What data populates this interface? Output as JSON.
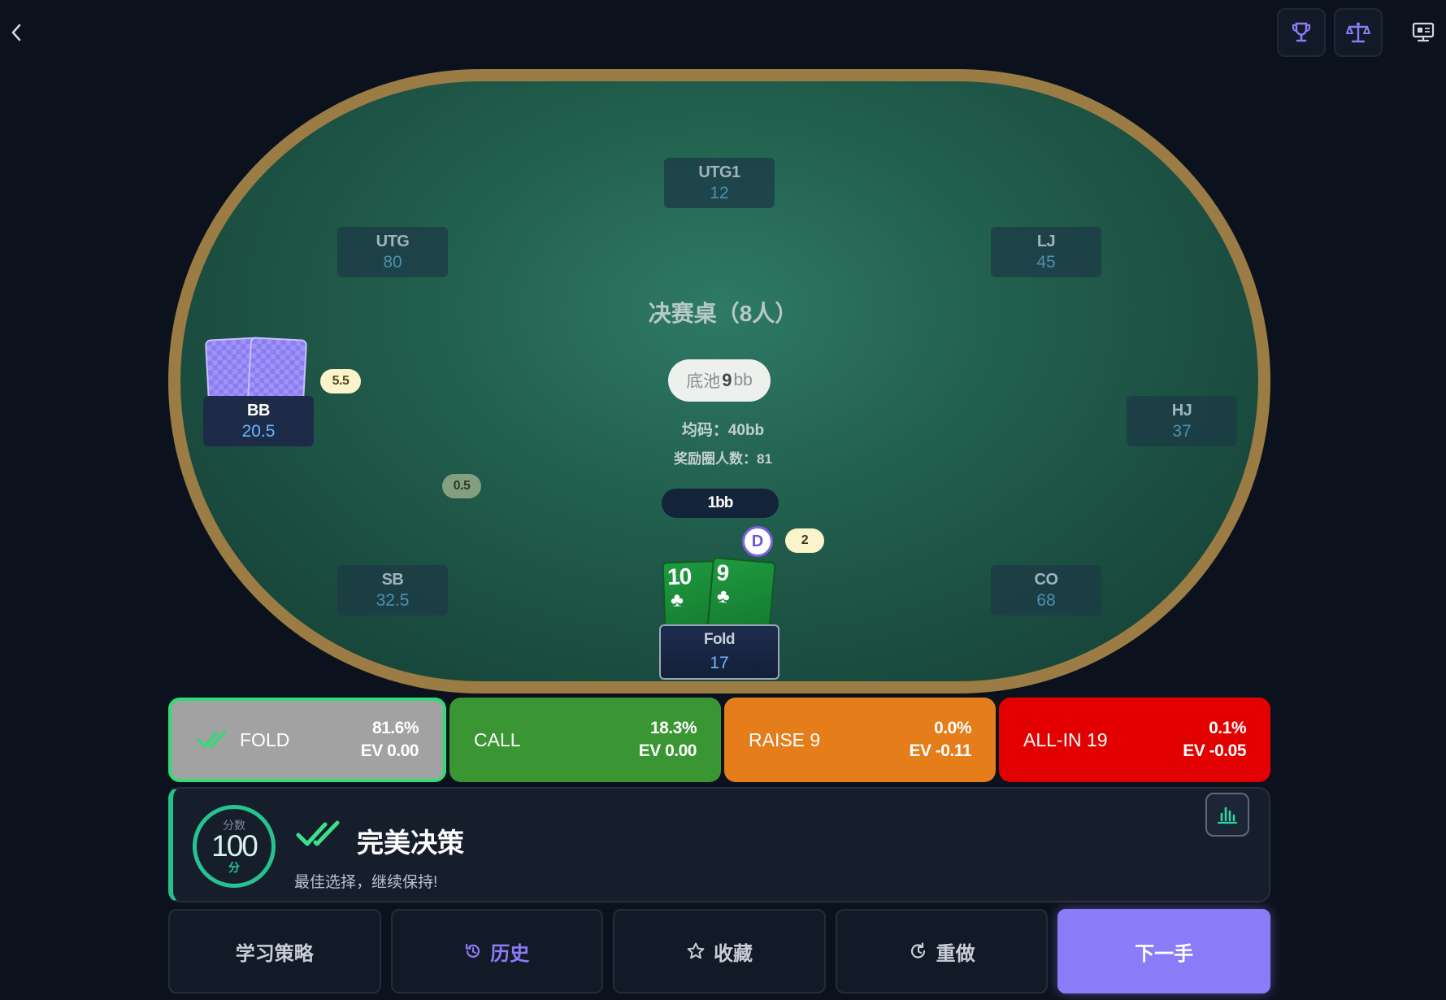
{
  "header": {
    "back_icon": "chevron-left-icon",
    "buttons": [
      {
        "name": "trophy-button",
        "icon": "trophy-icon"
      },
      {
        "name": "scale-button",
        "icon": "scale-icon"
      }
    ],
    "monitor_icon": "monitor-icon"
  },
  "table": {
    "title": "决赛桌（8人）",
    "pot_prefix": "底池",
    "pot_value": "9",
    "pot_unit": "bb",
    "avg_stack": "均码：40bb",
    "prize_count": "奖励圈人数：81",
    "blind_pill": "1bb",
    "dealer_label": "D",
    "felt_color": "#23614f",
    "rail_color": "#9b7c44"
  },
  "seats": {
    "utg1": {
      "pos": "UTG1",
      "stack": "12"
    },
    "utg": {
      "pos": "UTG",
      "stack": "80"
    },
    "lj": {
      "pos": "LJ",
      "stack": "45"
    },
    "bb": {
      "pos": "BB",
      "stack": "20.5"
    },
    "hj": {
      "pos": "HJ",
      "stack": "37"
    },
    "sb": {
      "pos": "SB",
      "stack": "32.5"
    },
    "co": {
      "pos": "CO",
      "stack": "68"
    },
    "hero": {
      "action": "Fold",
      "stack": "17"
    }
  },
  "bets": {
    "bb": "5.5",
    "sb": "0.5",
    "hero": "2"
  },
  "hero_cards": [
    {
      "rank": "10",
      "suit": "♣"
    },
    {
      "rank": "9",
      "suit": "♣"
    }
  ],
  "actions": [
    {
      "label": "FOLD",
      "pct": "81.6%",
      "ev": "EV 0.00",
      "color": "#a2a2a2",
      "selected": true
    },
    {
      "label": "CALL",
      "pct": "18.3%",
      "ev": "EV 0.00",
      "color": "#3a9632"
    },
    {
      "label": "RAISE 9",
      "pct": "0.0%",
      "ev": "EV -0.11",
      "color": "#e57d1b"
    },
    {
      "label": "ALL-IN 19",
      "pct": "0.1%",
      "ev": "EV -0.05",
      "color": "#e20000"
    }
  ],
  "result": {
    "score_label": "分数",
    "score": "100",
    "score_unit": "分",
    "verdict": "完美决策",
    "subtitle": "最佳选择，继续保持!",
    "accent": "#25c08a"
  },
  "bottom": {
    "study": "学习策略",
    "history": "历史",
    "favorite": "收藏",
    "redo": "重做",
    "next": "下一手",
    "primary_color": "#8a7cf6"
  }
}
